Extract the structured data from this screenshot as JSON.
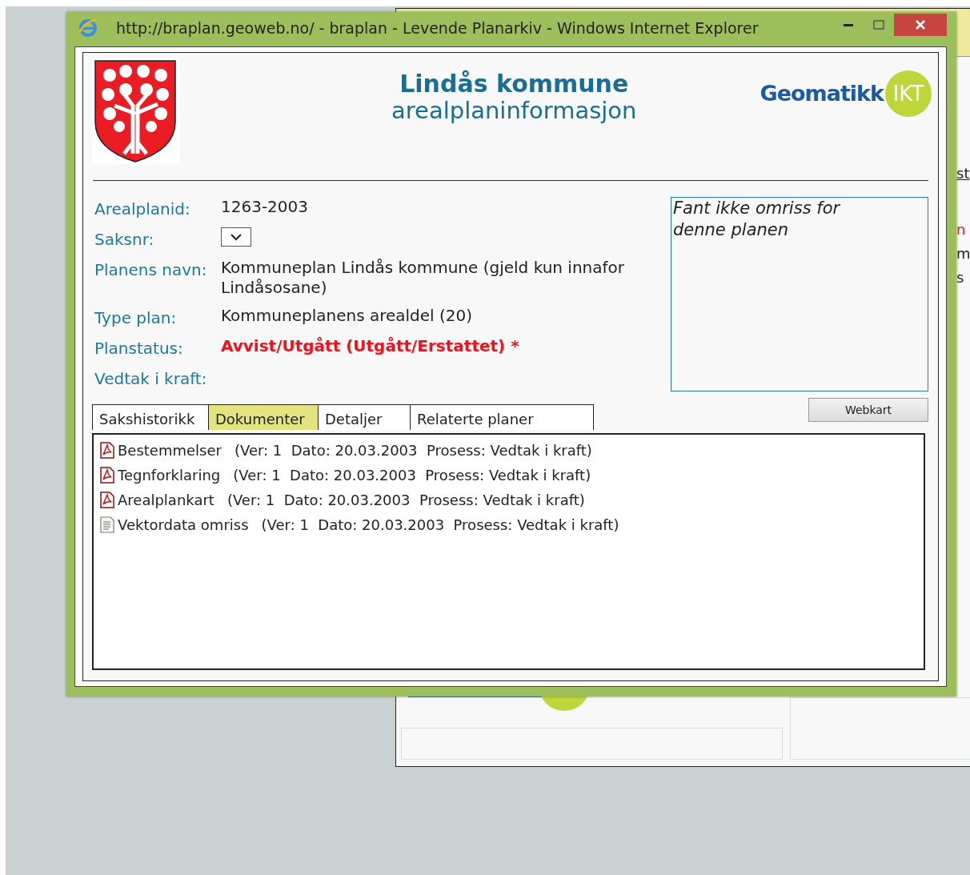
{
  "window": {
    "title": "http://braplan.geoweb.no/ - braplan - Levende Planarkiv - Windows Internet Explorer"
  },
  "header": {
    "title": "Lindås kommune",
    "subtitle": "arealplaninformasjon",
    "logo_text": "Geomatikk",
    "logo_badge": "IKT"
  },
  "fields": [
    {
      "label": "Arealplanid:",
      "kind": "text",
      "value": "1263-2003"
    },
    {
      "label": "Saksnr:",
      "kind": "select"
    },
    {
      "label": "Planens navn:",
      "kind": "text",
      "value": "Kommuneplan Lindås kommune (gjeld kun innafor Lindåsosane)"
    },
    {
      "label": "Type plan:",
      "kind": "text",
      "value": "Kommuneplanens arealdel (20)"
    },
    {
      "label": "Planstatus:",
      "kind": "alert",
      "value": "Avvist/Utgått (Utgått/Erstattet) *"
    },
    {
      "label": "Vedtak i kraft:",
      "kind": "text"
    }
  ],
  "map_box": {
    "message": "Fant ikke omriss for denne planen"
  },
  "webkart_button": "Webkart",
  "tabs": [
    {
      "label": "Sakshistorikk",
      "selected": false
    },
    {
      "label": "Dokumenter",
      "selected": true
    },
    {
      "label": "Detaljer",
      "selected": false
    },
    {
      "label": "Relaterte planer",
      "selected": false
    }
  ],
  "documents": [
    {
      "kind": "pdf",
      "name": "Bestemmelser",
      "details": "(Ver: 1  Dato: 20.03.2003  Prosess: Vedtak i kraft)"
    },
    {
      "kind": "pdf",
      "name": "Tegnforklaring",
      "details": "(Ver: 1  Dato: 20.03.2003  Prosess: Vedtak i kraft)"
    },
    {
      "kind": "pdf",
      "name": "Arealplankart",
      "details": "(Ver: 1  Dato: 20.03.2003  Prosess: Vedtak i kraft)"
    },
    {
      "kind": "text",
      "name": "Vektordata omriss",
      "details": "(Ver: 1  Dato: 20.03.2003  Prosess: Vedtak i kraft)"
    }
  ],
  "background_window": {
    "fragments": [
      {
        "text": "st",
        "kind": "link"
      },
      {
        "text": "n",
        "kind": "alert"
      },
      {
        "text": "m",
        "kind": "text"
      },
      {
        "text": "s",
        "kind": "text"
      }
    ]
  }
}
